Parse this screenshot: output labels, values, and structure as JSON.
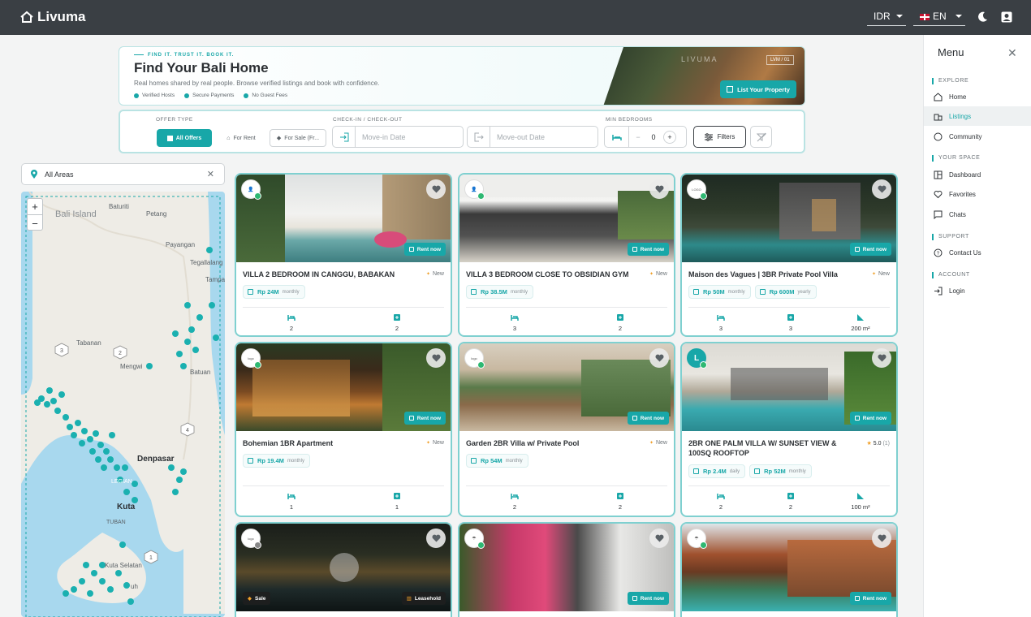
{
  "app": {
    "name": "Livuma"
  },
  "topbar": {
    "currency": "IDR",
    "language": "EN"
  },
  "menu": {
    "title": "Menu",
    "sections": [
      {
        "label": "EXPLORE",
        "items": [
          {
            "label": "Home"
          },
          {
            "label": "Listings"
          },
          {
            "label": "Community"
          }
        ]
      },
      {
        "label": "YOUR SPACE",
        "items": [
          {
            "label": "Dashboard"
          },
          {
            "label": "Favorites"
          },
          {
            "label": "Chats"
          }
        ]
      },
      {
        "label": "SUPPORT",
        "items": [
          {
            "label": "Contact Us"
          }
        ]
      },
      {
        "label": "ACCOUNT",
        "items": [
          {
            "label": "Login"
          }
        ]
      }
    ]
  },
  "hero": {
    "tagline": "FIND IT. TRUST IT. BOOK IT.",
    "title": "Find Your Bali Home",
    "subtitle": "Real homes shared by real people. Browse verified listings and book with confidence.",
    "badges": [
      "Verified Hosts",
      "Secure Payments",
      "No Guest Fees"
    ],
    "brand": "LIVUMA",
    "code": "LVM / 01",
    "cta": "List Your Property"
  },
  "filters": {
    "offer_type_label": "OFFER TYPE",
    "offer_types": [
      "All Offers",
      "For Rent",
      "For Sale (Fr..."
    ],
    "dates_label": "CHECK-IN / CHECK-OUT",
    "move_in_placeholder": "Move-in Date",
    "move_out_placeholder": "Move-out Date",
    "bedrooms_label": "MIN BEDROOMS",
    "bedrooms_value": "0",
    "filters_button": "Filters"
  },
  "map": {
    "search_value": "All Areas",
    "labels": [
      "Bali Island",
      "Baturiti",
      "Petang",
      "Payangan",
      "Tegallalang",
      "Tampa",
      "Tabanan",
      "Mengwi",
      "Batuan",
      "Denpasar",
      "LEGIAN",
      "Kuta",
      "TUBAN",
      "Kuta Selatan",
      "uh"
    ],
    "route_numbers": [
      "3",
      "2",
      "4",
      "1"
    ]
  },
  "listings": [
    {
      "title": "VILLA 2 BEDROOM IN CANGGU, BABAKAN",
      "tag": "New",
      "prices": [
        {
          "amount": "Rp 24M",
          "period": "monthly"
        }
      ],
      "beds": "2",
      "baths": "2",
      "area": "",
      "badge": "Rent now"
    },
    {
      "title": "VILLA 3 BEDROOM CLOSE TO OBSIDIAN GYM",
      "tag": "New",
      "prices": [
        {
          "amount": "Rp 38.5M",
          "period": "monthly"
        }
      ],
      "beds": "3",
      "baths": "2",
      "area": "",
      "badge": "Rent now"
    },
    {
      "title": "Maison des Vagues | 3BR Private Pool Villa",
      "tag": "New",
      "prices": [
        {
          "amount": "Rp 50M",
          "period": "monthly"
        },
        {
          "amount": "Rp 600M",
          "period": "yearly"
        }
      ],
      "beds": "3",
      "baths": "3",
      "area": "200 m²",
      "badge": "Rent now"
    },
    {
      "title": "Bohemian 1BR Apartment",
      "tag": "New",
      "prices": [
        {
          "amount": "Rp 19.4M",
          "period": "monthly"
        }
      ],
      "beds": "1",
      "baths": "1",
      "area": "",
      "badge": "Rent now"
    },
    {
      "title": "Garden 2BR Villa w/ Private Pool",
      "tag": "New",
      "prices": [
        {
          "amount": "Rp 54M",
          "period": "monthly"
        }
      ],
      "beds": "2",
      "baths": "2",
      "area": "",
      "badge": "Rent now"
    },
    {
      "title": "2BR ONE PALM VILLA W/ SUNSET VIEW & 100SQ ROOFTOP",
      "tag": "5.0",
      "tag_count": "(1)",
      "prices": [
        {
          "amount": "Rp 2.4M",
          "period": "daily"
        },
        {
          "amount": "Rp 52M",
          "period": "monthly"
        }
      ],
      "beds": "2",
      "baths": "2",
      "area": "100 m²",
      "badge": "Rent now"
    },
    {
      "title": "",
      "badges": [
        "Sale",
        "Leasehold"
      ]
    },
    {
      "title": "",
      "badge": "Rent now"
    },
    {
      "title": "",
      "badge": "Rent now"
    }
  ],
  "colors": {
    "accent": "#18a7a8",
    "topbar": "#3a3f44",
    "card_border": "#7fd0d0"
  }
}
